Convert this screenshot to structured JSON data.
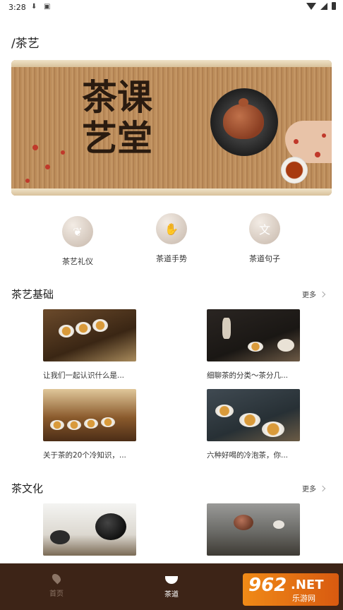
{
  "status": {
    "time": "3:28"
  },
  "page": {
    "title": "/茶艺"
  },
  "banner": {
    "line1": "茶课",
    "line2": "艺堂"
  },
  "categories": [
    {
      "label": "茶艺礼仪",
      "icon": "leaf-icon"
    },
    {
      "label": "茶道手势",
      "icon": "hand-icon"
    },
    {
      "label": "茶道句子",
      "icon": "text-icon",
      "glyph": "文"
    }
  ],
  "section1": {
    "title": "茶艺基础",
    "more": "更多",
    "cards": [
      {
        "caption": "让我们一起认识什么是..."
      },
      {
        "caption": "细聊茶的分类～茶分几..."
      },
      {
        "caption": "关于茶的20个冷知识，..."
      },
      {
        "caption": "六种好喝的冷泡茶，你..."
      }
    ]
  },
  "section2": {
    "title": "茶文化",
    "more": "更多"
  },
  "tabbar": {
    "home": "首页",
    "tea": "茶道"
  },
  "watermark": {
    "num": "962",
    "net": ".NET",
    "sub": "乐游网"
  }
}
